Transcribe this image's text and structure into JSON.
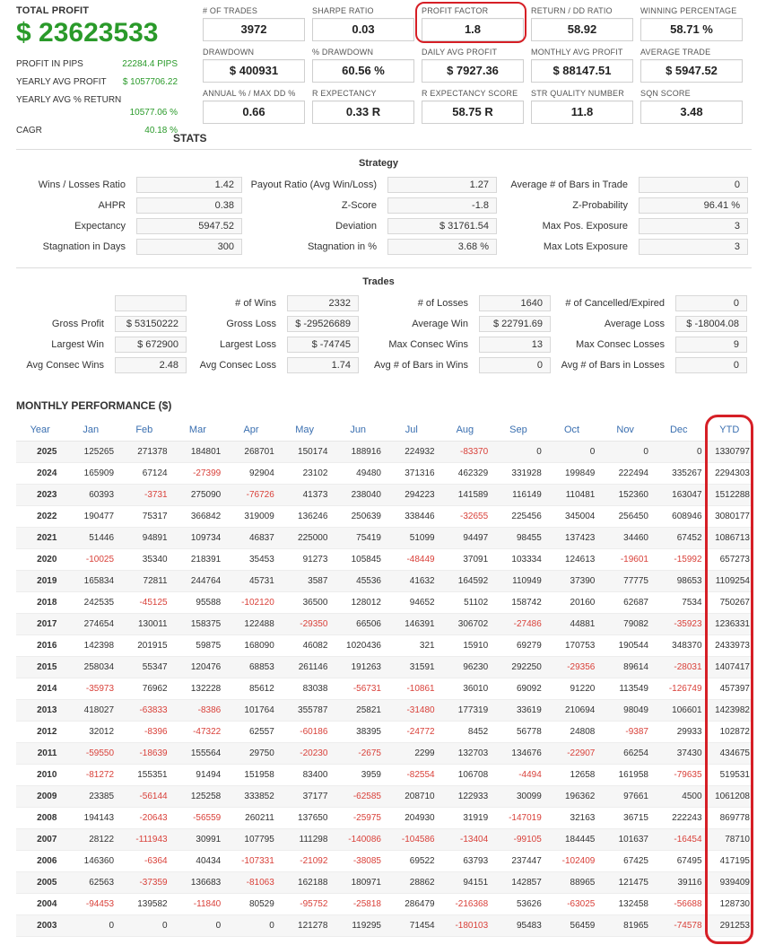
{
  "summary": {
    "total_profit_label": "TOTAL PROFIT",
    "total_profit_value": "$ 23623533",
    "rows": [
      {
        "label": "PROFIT IN PIPS",
        "value": "22284.4 PIPS"
      },
      {
        "label": "YEARLY AVG PROFIT",
        "value": "$ 1057706.22"
      },
      {
        "label": "YEARLY AVG % RETURN",
        "value": "10577.06 %"
      },
      {
        "label": "CAGR",
        "value": "40.18 %"
      }
    ]
  },
  "metrics": [
    {
      "label": "# OF TRADES",
      "value": "3972"
    },
    {
      "label": "SHARPE RATIO",
      "value": "0.03"
    },
    {
      "label": "PROFIT FACTOR",
      "value": "1.8"
    },
    {
      "label": "RETURN / DD RATIO",
      "value": "58.92"
    },
    {
      "label": "WINNING PERCENTAGE",
      "value": "58.71 %"
    },
    {
      "label": "DRAWDOWN",
      "value": "$ 400931"
    },
    {
      "label": "% DRAWDOWN",
      "value": "60.56 %"
    },
    {
      "label": "DAILY AVG PROFIT",
      "value": "$ 7927.36"
    },
    {
      "label": "MONTHLY AVG PROFIT",
      "value": "$ 88147.51"
    },
    {
      "label": "AVERAGE TRADE",
      "value": "$ 5947.52"
    },
    {
      "label": "ANNUAL % / MAX DD %",
      "value": "0.66"
    },
    {
      "label": "R EXPECTANCY",
      "value": "0.33 R"
    },
    {
      "label": "R EXPECTANCY SCORE",
      "value": "58.75 R"
    },
    {
      "label": "STR QUALITY NUMBER",
      "value": "11.8"
    },
    {
      "label": "SQN SCORE",
      "value": "3.48"
    }
  ],
  "stats_title": "STATS",
  "strategy": {
    "title": "Strategy",
    "rows": [
      [
        {
          "label": "Wins / Losses Ratio",
          "value": "1.42"
        },
        {
          "label": "Payout Ratio (Avg Win/Loss)",
          "value": "1.27"
        },
        {
          "label": "Average # of Bars in Trade",
          "value": "0"
        }
      ],
      [
        {
          "label": "AHPR",
          "value": "0.38"
        },
        {
          "label": "Z-Score",
          "value": "-1.8"
        },
        {
          "label": "Z-Probability",
          "value": "96.41 %"
        }
      ],
      [
        {
          "label": "Expectancy",
          "value": "5947.52"
        },
        {
          "label": "Deviation",
          "value": "$ 31761.54"
        },
        {
          "label": "Max Pos. Exposure",
          "value": "3"
        }
      ],
      [
        {
          "label": "Stagnation in Days",
          "value": "300"
        },
        {
          "label": "Stagnation in %",
          "value": "3.68 %"
        },
        {
          "label": "Max Lots Exposure",
          "value": "3"
        }
      ]
    ]
  },
  "trades": {
    "title": "Trades",
    "rows": [
      [
        {
          "label": "",
          "value": ""
        },
        {
          "label": "# of Wins",
          "value": "2332"
        },
        {
          "label": "# of Losses",
          "value": "1640"
        },
        {
          "label": "# of Cancelled/Expired",
          "value": "0"
        }
      ],
      [
        {
          "label": "Gross Profit",
          "value": "$ 53150222"
        },
        {
          "label": "Gross Loss",
          "value": "$ -29526689"
        },
        {
          "label": "Average Win",
          "value": "$ 22791.69"
        },
        {
          "label": "Average Loss",
          "value": "$ -18004.08"
        }
      ],
      [
        {
          "label": "Largest Win",
          "value": "$ 672900"
        },
        {
          "label": "Largest Loss",
          "value": "$ -74745"
        },
        {
          "label": "Max Consec Wins",
          "value": "13"
        },
        {
          "label": "Max Consec Losses",
          "value": "9"
        }
      ],
      [
        {
          "label": "Avg Consec Wins",
          "value": "2.48"
        },
        {
          "label": "Avg Consec Loss",
          "value": "1.74"
        },
        {
          "label": "Avg # of Bars in Wins",
          "value": "0"
        },
        {
          "label": "Avg # of Bars in Losses",
          "value": "0"
        }
      ]
    ]
  },
  "monthly": {
    "title": "MONTHLY PERFORMANCE ($)",
    "headers": [
      "Year",
      "Jan",
      "Feb",
      "Mar",
      "Apr",
      "May",
      "Jun",
      "Jul",
      "Aug",
      "Sep",
      "Oct",
      "Nov",
      "Dec",
      "YTD"
    ],
    "rows": [
      [
        "2025",
        "125265",
        "271378",
        "184801",
        "268701",
        "150174",
        "188916",
        "224932",
        "-83370",
        "0",
        "0",
        "0",
        "0",
        "1330797"
      ],
      [
        "2024",
        "165909",
        "67124",
        "-27399",
        "92904",
        "23102",
        "49480",
        "371316",
        "462329",
        "331928",
        "199849",
        "222494",
        "335267",
        "2294303"
      ],
      [
        "2023",
        "60393",
        "-3731",
        "275090",
        "-76726",
        "41373",
        "238040",
        "294223",
        "141589",
        "116149",
        "110481",
        "152360",
        "163047",
        "1512288"
      ],
      [
        "2022",
        "190477",
        "75317",
        "366842",
        "319009",
        "136246",
        "250639",
        "338446",
        "-32655",
        "225456",
        "345004",
        "256450",
        "608946",
        "3080177"
      ],
      [
        "2021",
        "51446",
        "94891",
        "109734",
        "46837",
        "225000",
        "75419",
        "51099",
        "94497",
        "98455",
        "137423",
        "34460",
        "67452",
        "1086713"
      ],
      [
        "2020",
        "-10025",
        "35340",
        "218391",
        "35453",
        "91273",
        "105845",
        "-48449",
        "37091",
        "103334",
        "124613",
        "-19601",
        "-15992",
        "657273"
      ],
      [
        "2019",
        "165834",
        "72811",
        "244764",
        "45731",
        "3587",
        "45536",
        "41632",
        "164592",
        "110949",
        "37390",
        "77775",
        "98653",
        "1109254"
      ],
      [
        "2018",
        "242535",
        "-45125",
        "95588",
        "-102120",
        "36500",
        "128012",
        "94652",
        "51102",
        "158742",
        "20160",
        "62687",
        "7534",
        "750267"
      ],
      [
        "2017",
        "274654",
        "130011",
        "158375",
        "122488",
        "-29350",
        "66506",
        "146391",
        "306702",
        "-27486",
        "44881",
        "79082",
        "-35923",
        "1236331"
      ],
      [
        "2016",
        "142398",
        "201915",
        "59875",
        "168090",
        "46082",
        "1020436",
        "321",
        "15910",
        "69279",
        "170753",
        "190544",
        "348370",
        "2433973"
      ],
      [
        "2015",
        "258034",
        "55347",
        "120476",
        "68853",
        "261146",
        "191263",
        "31591",
        "96230",
        "292250",
        "-29356",
        "89614",
        "-28031",
        "1407417"
      ],
      [
        "2014",
        "-35973",
        "76962",
        "132228",
        "85612",
        "83038",
        "-56731",
        "-10861",
        "36010",
        "69092",
        "91220",
        "113549",
        "-126749",
        "457397"
      ],
      [
        "2013",
        "418027",
        "-63833",
        "-8386",
        "101764",
        "355787",
        "25821",
        "-31480",
        "177319",
        "33619",
        "210694",
        "98049",
        "106601",
        "1423982"
      ],
      [
        "2012",
        "32012",
        "-8396",
        "-47322",
        "62557",
        "-60186",
        "38395",
        "-24772",
        "8452",
        "56778",
        "24808",
        "-9387",
        "29933",
        "102872"
      ],
      [
        "2011",
        "-59550",
        "-18639",
        "155564",
        "29750",
        "-20230",
        "-2675",
        "2299",
        "132703",
        "134676",
        "-22907",
        "66254",
        "37430",
        "434675"
      ],
      [
        "2010",
        "-81272",
        "155351",
        "91494",
        "151958",
        "83400",
        "3959",
        "-82554",
        "106708",
        "-4494",
        "12658",
        "161958",
        "-79635",
        "519531"
      ],
      [
        "2009",
        "23385",
        "-56144",
        "125258",
        "333852",
        "37177",
        "-62585",
        "208710",
        "122933",
        "30099",
        "196362",
        "97661",
        "4500",
        "1061208"
      ],
      [
        "2008",
        "194143",
        "-20643",
        "-56559",
        "260211",
        "137650",
        "-25975",
        "204930",
        "31919",
        "-147019",
        "32163",
        "36715",
        "222243",
        "869778"
      ],
      [
        "2007",
        "28122",
        "-111943",
        "30991",
        "107795",
        "111298",
        "-140086",
        "-104586",
        "-13404",
        "-99105",
        "184445",
        "101637",
        "-16454",
        "78710"
      ],
      [
        "2006",
        "146360",
        "-6364",
        "40434",
        "-107331",
        "-21092",
        "-38085",
        "69522",
        "63793",
        "237447",
        "-102409",
        "67425",
        "67495",
        "417195"
      ],
      [
        "2005",
        "62563",
        "-37359",
        "136683",
        "-81063",
        "162188",
        "180971",
        "28862",
        "94151",
        "142857",
        "88965",
        "121475",
        "39116",
        "939409"
      ],
      [
        "2004",
        "-94453",
        "139582",
        "-11840",
        "80529",
        "-95752",
        "-25818",
        "286479",
        "-216368",
        "53626",
        "-63025",
        "132458",
        "-56688",
        "128730"
      ],
      [
        "2003",
        "0",
        "0",
        "0",
        "0",
        "121278",
        "119295",
        "71454",
        "-180103",
        "95483",
        "56459",
        "81965",
        "-74578",
        "291253"
      ]
    ]
  },
  "colors": {
    "profit_green": "#2a9a2a",
    "negative_red": "#d9413a",
    "header_blue": "#3a6fb0",
    "highlight_red": "#d61f26"
  }
}
